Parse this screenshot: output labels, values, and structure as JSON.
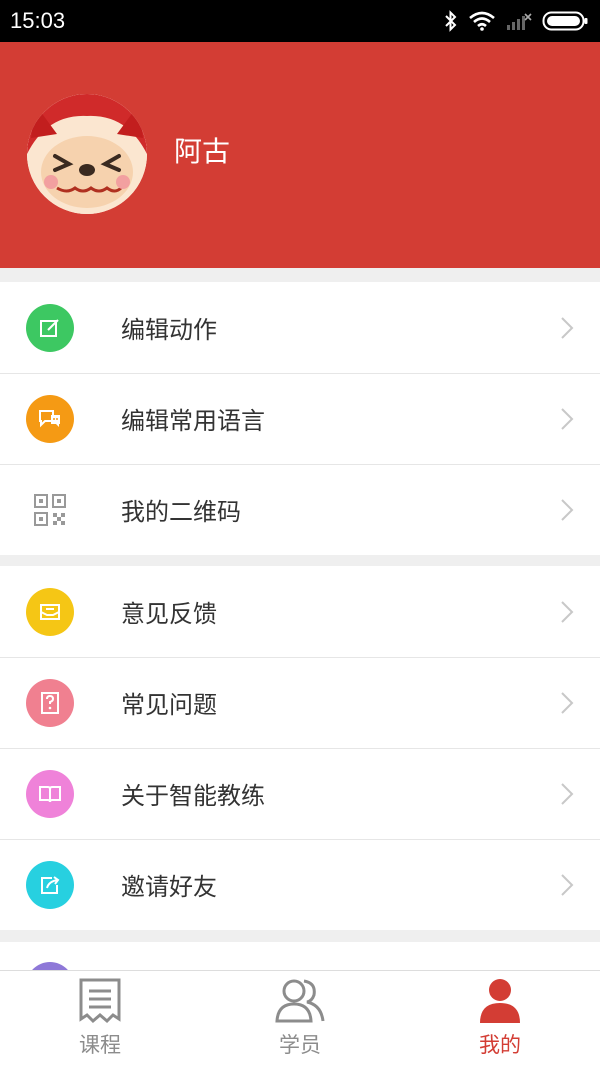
{
  "status_bar": {
    "time": "15:03"
  },
  "profile": {
    "name": "阿古"
  },
  "menu_groups": [
    [
      {
        "label": "编辑动作",
        "icon": "edit-icon",
        "color": "#3dc862"
      },
      {
        "label": "编辑常用语言",
        "icon": "chat-icon",
        "color": "#f59a14"
      },
      {
        "label": "我的二维码",
        "icon": "qrcode-icon",
        "color": "#ffffff"
      }
    ],
    [
      {
        "label": "意见反馈",
        "icon": "feedback-mail-icon",
        "color": "#f5c615"
      },
      {
        "label": "常见问题",
        "icon": "question-icon",
        "color": "#f08090"
      },
      {
        "label": "关于智能教练",
        "icon": "book-icon",
        "color": "#ef82d9"
      },
      {
        "label": "邀请好友",
        "icon": "share-icon",
        "color": "#27d0e0"
      }
    ]
  ],
  "tabbar": {
    "tabs": [
      {
        "label": "课程",
        "icon": "course-list-icon",
        "active": false
      },
      {
        "label": "学员",
        "icon": "students-icon",
        "active": false
      },
      {
        "label": "我的",
        "icon": "profile-icon",
        "active": true
      }
    ],
    "active_color": "#d33d34",
    "inactive_color": "#8c8c8c"
  },
  "colors": {
    "header": "#d33d34"
  }
}
